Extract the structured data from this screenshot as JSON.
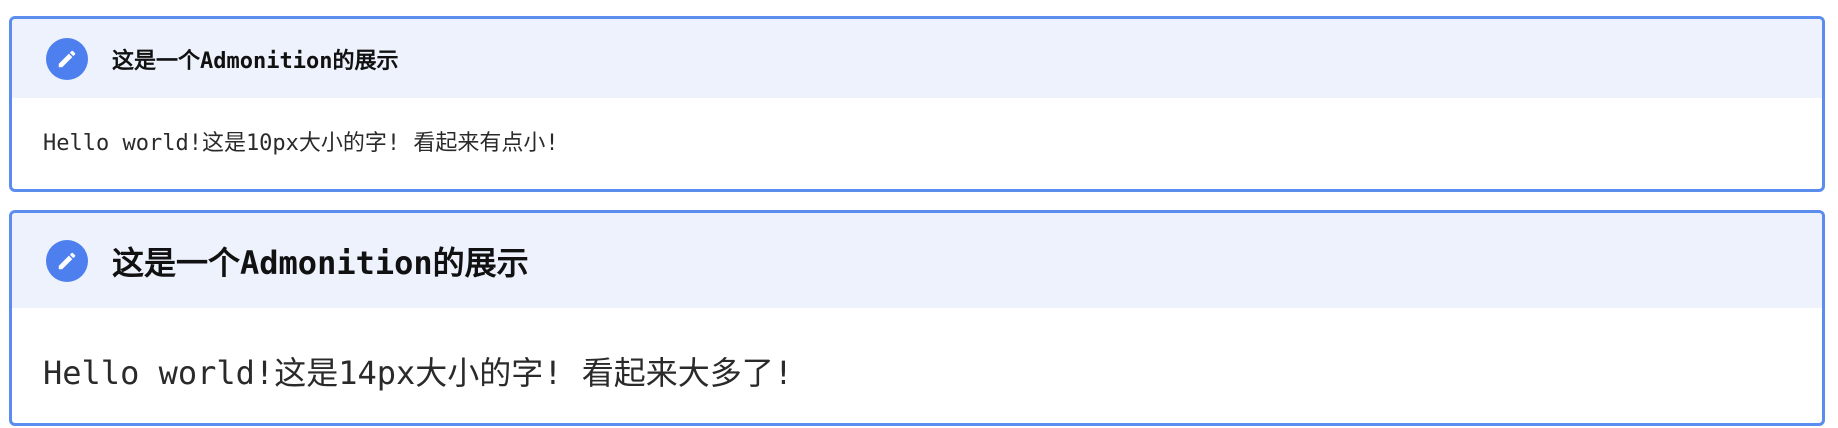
{
  "admonitions": [
    {
      "icon": "pencil-icon",
      "title": "这是一个Admonition的展示",
      "body": "Hello world!这是10px大小的字! 看起来有点小!"
    },
    {
      "icon": "pencil-icon",
      "title": "这是一个Admonition的展示",
      "body": "Hello world!这是14px大小的字! 看起来大多了!"
    }
  ],
  "colors": {
    "border": "#5b8def",
    "title_background": "#edf2fd",
    "icon_background": "#4d7fee",
    "text": "#111111"
  }
}
